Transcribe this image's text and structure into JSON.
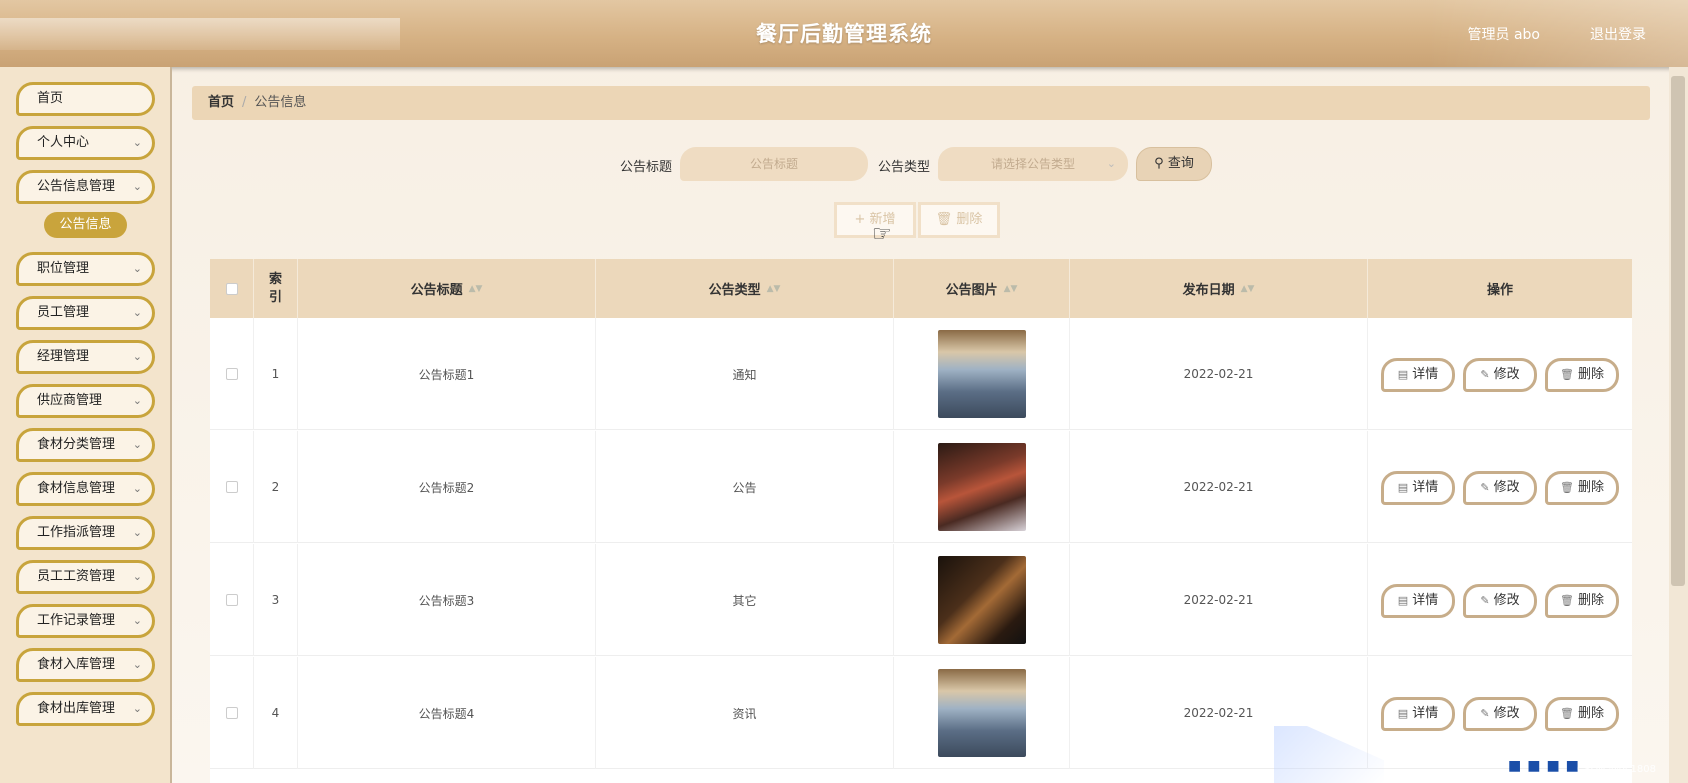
{
  "header": {
    "title": "餐厅后勤管理系统",
    "user": "管理员 abo",
    "logout": "退出登录"
  },
  "sidebar": {
    "items": [
      {
        "label": "首页",
        "has_chevron": false
      },
      {
        "label": "个人中心",
        "has_chevron": true
      },
      {
        "label": "公告信息管理",
        "has_chevron": true
      },
      {
        "label": "职位管理",
        "has_chevron": true
      },
      {
        "label": "员工管理",
        "has_chevron": true
      },
      {
        "label": "经理管理",
        "has_chevron": true
      },
      {
        "label": "供应商管理",
        "has_chevron": true
      },
      {
        "label": "食材分类管理",
        "has_chevron": true
      },
      {
        "label": "食材信息管理",
        "has_chevron": true
      },
      {
        "label": "工作指派管理",
        "has_chevron": true
      },
      {
        "label": "员工工资管理",
        "has_chevron": true
      },
      {
        "label": "工作记录管理",
        "has_chevron": true
      },
      {
        "label": "食材入库管理",
        "has_chevron": true
      },
      {
        "label": "食材出库管理",
        "has_chevron": true
      }
    ],
    "active_submenu": "公告信息"
  },
  "breadcrumb": {
    "home": "首页",
    "sep": "/",
    "current": "公告信息"
  },
  "search": {
    "title_label": "公告标题",
    "title_placeholder": "公告标题",
    "type_label": "公告类型",
    "type_placeholder": "请选择公告类型",
    "query_label": "查询"
  },
  "actions": {
    "add_label": "+ 新增",
    "delete_label": "删除"
  },
  "table": {
    "columns": [
      "索引",
      "公告标题",
      "公告类型",
      "公告图片",
      "发布日期",
      "操作"
    ],
    "rows": [
      {
        "index": "1",
        "title": "公告标题1",
        "type": "通知",
        "date": "2022-02-21",
        "image": "restaurant-hall"
      },
      {
        "index": "2",
        "title": "公告标题2",
        "type": "公告",
        "date": "2022-02-21",
        "image": "restaurant-dark-red"
      },
      {
        "index": "3",
        "title": "公告标题3",
        "type": "其它",
        "date": "2022-02-21",
        "image": "restaurant-dark-wood"
      },
      {
        "index": "4",
        "title": "公告标题4",
        "type": "资讯",
        "date": "2022-02-21",
        "image": "restaurant-hall"
      }
    ],
    "row_actions": {
      "detail": "详情",
      "edit": "修改",
      "delete": "删除"
    }
  },
  "watermark": "CSDN @gc1808",
  "colors": {
    "accent": "#c8a43c",
    "header_bg": "#d6b285",
    "table_header_bg": "#ecd8bb"
  }
}
